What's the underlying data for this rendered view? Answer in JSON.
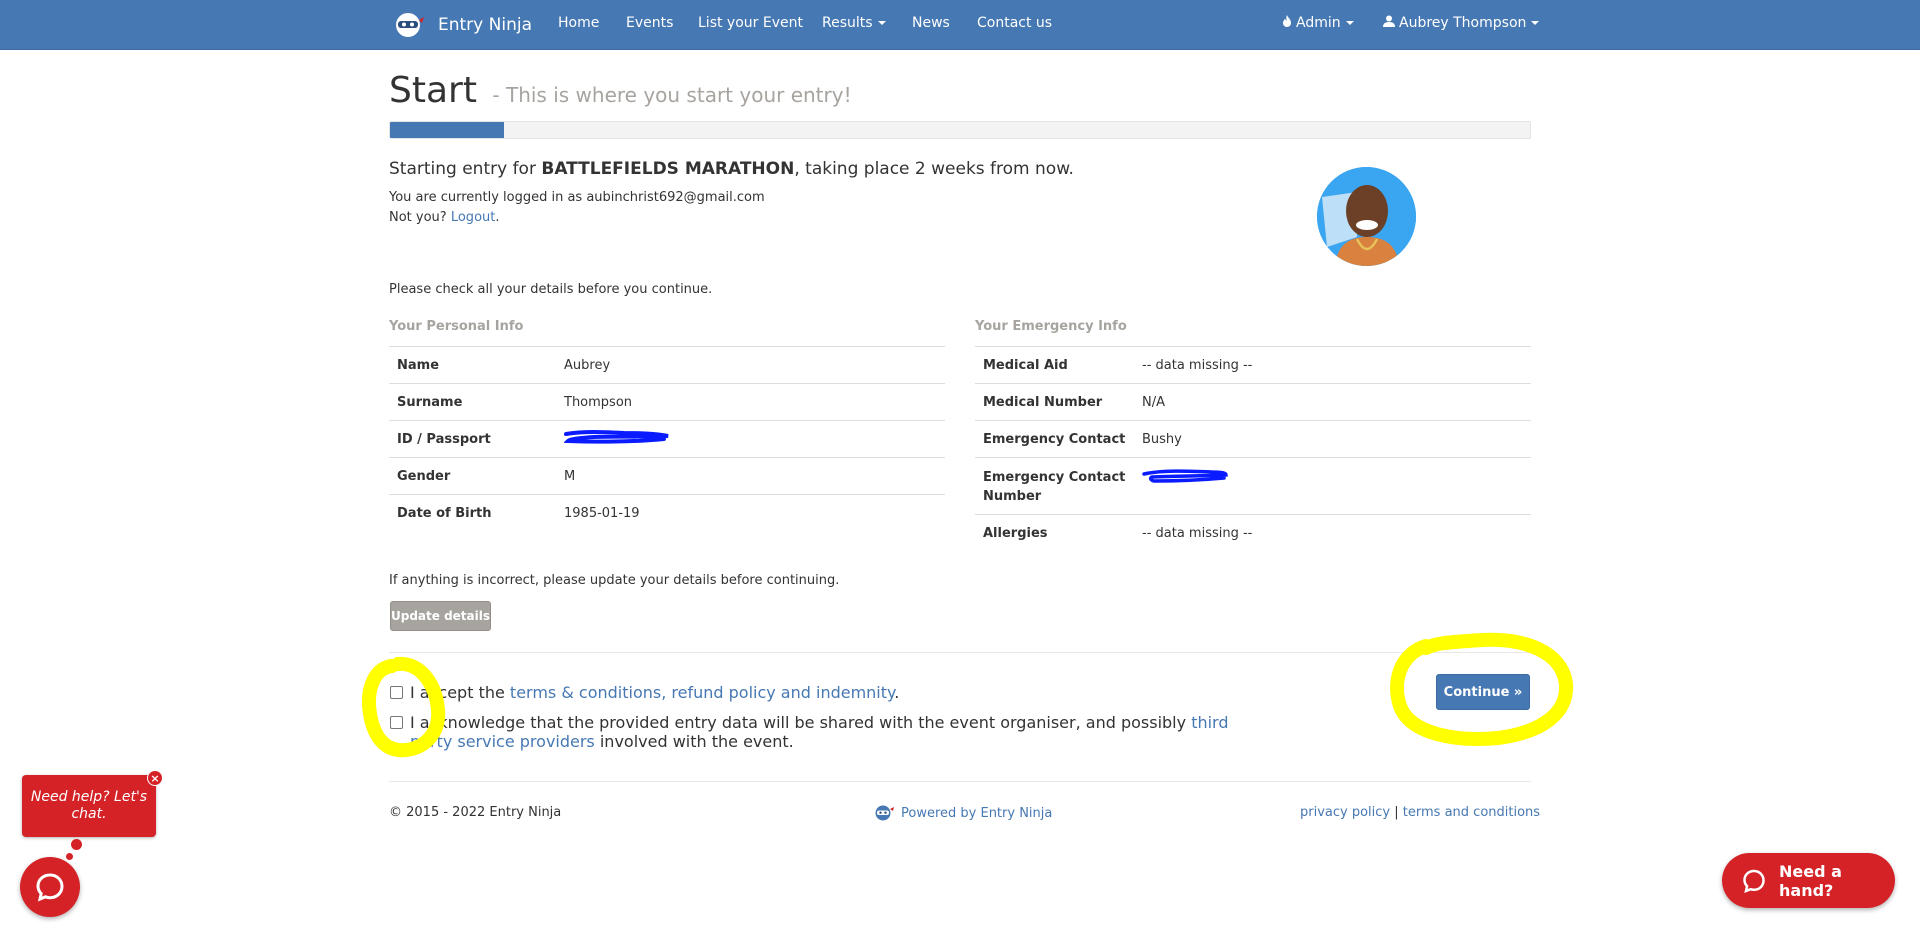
{
  "navbar": {
    "brand": "Entry Ninja",
    "links": [
      "Home",
      "Events",
      "List your Event",
      "Results",
      "News",
      "Contact us"
    ],
    "admin_label": "Admin",
    "user_label": "Aubrey Thompson"
  },
  "header": {
    "title": "Start",
    "subtitle": "- This is where you start your entry!"
  },
  "progress": {
    "percent": 10
  },
  "intro": {
    "prefix": "Starting entry for",
    "event_name": "BATTLEFIELDS MARATHON",
    "suffix": ", taking place 2 weeks from now.",
    "logged_in_text": "You are currently logged in as aubinchrist692@gmail.com",
    "not_you_text": "Not you?",
    "logout_label": "Logout",
    "logout_period": "."
  },
  "check_note": "Please check all your details before you continue.",
  "personal_info": {
    "heading": "Your Personal Info",
    "rows": [
      {
        "label": "Name",
        "value": "Aubrey"
      },
      {
        "label": "Surname",
        "value": "Thompson"
      },
      {
        "label": "ID / Passport",
        "value": ""
      },
      {
        "label": "Gender",
        "value": "M"
      },
      {
        "label": "Date of Birth",
        "value": "1985-01-19"
      }
    ]
  },
  "emergency_info": {
    "heading": "Your Emergency Info",
    "rows": [
      {
        "label": "Medical Aid",
        "value": "-- data missing --"
      },
      {
        "label": "Medical Number",
        "value": "N/A"
      },
      {
        "label": "Emergency Contact",
        "value": "Bushy"
      },
      {
        "label": "Emergency Contact Number",
        "value": ""
      },
      {
        "label": "Allergies",
        "value": "-- data missing --"
      }
    ]
  },
  "update_note": "If anything is incorrect, please update your details before continuing.",
  "update_button": "Update details",
  "terms": {
    "accept_prefix": "I accept the",
    "accept_link": "terms & conditions, refund policy and indemnity",
    "accept_suffix": ".",
    "ack_prefix": "I acknowledge that the provided entry data will be shared with the event organiser, and possibly",
    "ack_link_1": "third",
    "ack_link_2": "party service providers",
    "ack_suffix": "involved with the event."
  },
  "continue_button": "Continue »",
  "footer": {
    "copyright": "© 2015 - 2022 Entry Ninja",
    "powered_by": "Powered by Entry Ninja",
    "privacy": "privacy policy",
    "separator": "|",
    "terms": "terms and conditions"
  },
  "chat": {
    "bubble_text": "Need help? Let's chat.",
    "close_label": "×",
    "need_hand": "Need a hand?"
  },
  "colors": {
    "navbar": "#4678b3",
    "link": "#4678b3",
    "muted": "#a7a49f",
    "chat_red": "#d42227",
    "highlight": "#ffff00"
  }
}
